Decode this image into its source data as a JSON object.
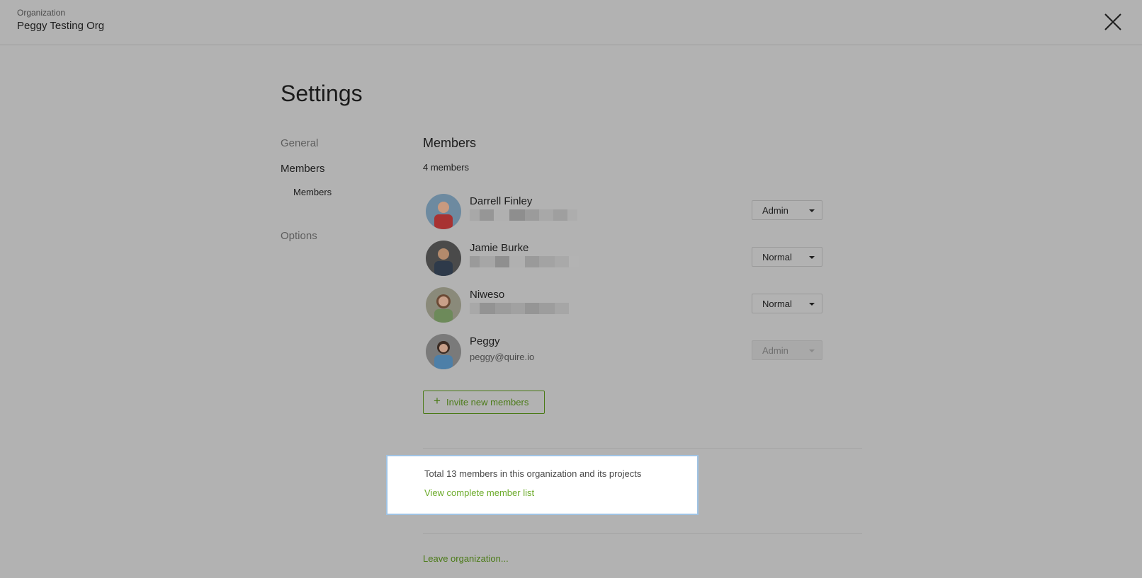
{
  "header": {
    "org_label": "Organization",
    "org_name": "Peggy Testing Org",
    "close_icon": "close-icon"
  },
  "page": {
    "title": "Settings"
  },
  "nav": {
    "general": "General",
    "members": "Members",
    "members_sub": "Members",
    "options": "Options"
  },
  "members_section": {
    "title": "Members",
    "count_text": "4 members",
    "members": [
      {
        "name": "Darrell Finley",
        "email": "",
        "role": "Admin",
        "editable": true
      },
      {
        "name": "Jamie Burke",
        "email": "",
        "role": "Normal",
        "editable": true
      },
      {
        "name": "Niweso",
        "email": "",
        "role": "Normal",
        "editable": true
      },
      {
        "name": "Peggy",
        "email": "peggy@quire.io",
        "role": "Admin",
        "editable": false
      }
    ],
    "invite_label": "Invite new members",
    "invite_icon": "plus-icon"
  },
  "summary": {
    "total_text": "Total 13 members in this organization and its projects",
    "view_list_label": "View complete member list"
  },
  "footer": {
    "leave_label": "Leave organization..."
  },
  "colors": {
    "overlay_bg": "#b2b2b2",
    "accent_green": "#4a7a16",
    "link_green_highlight": "#6cab2a",
    "highlight_border": "#9fc3e4"
  }
}
